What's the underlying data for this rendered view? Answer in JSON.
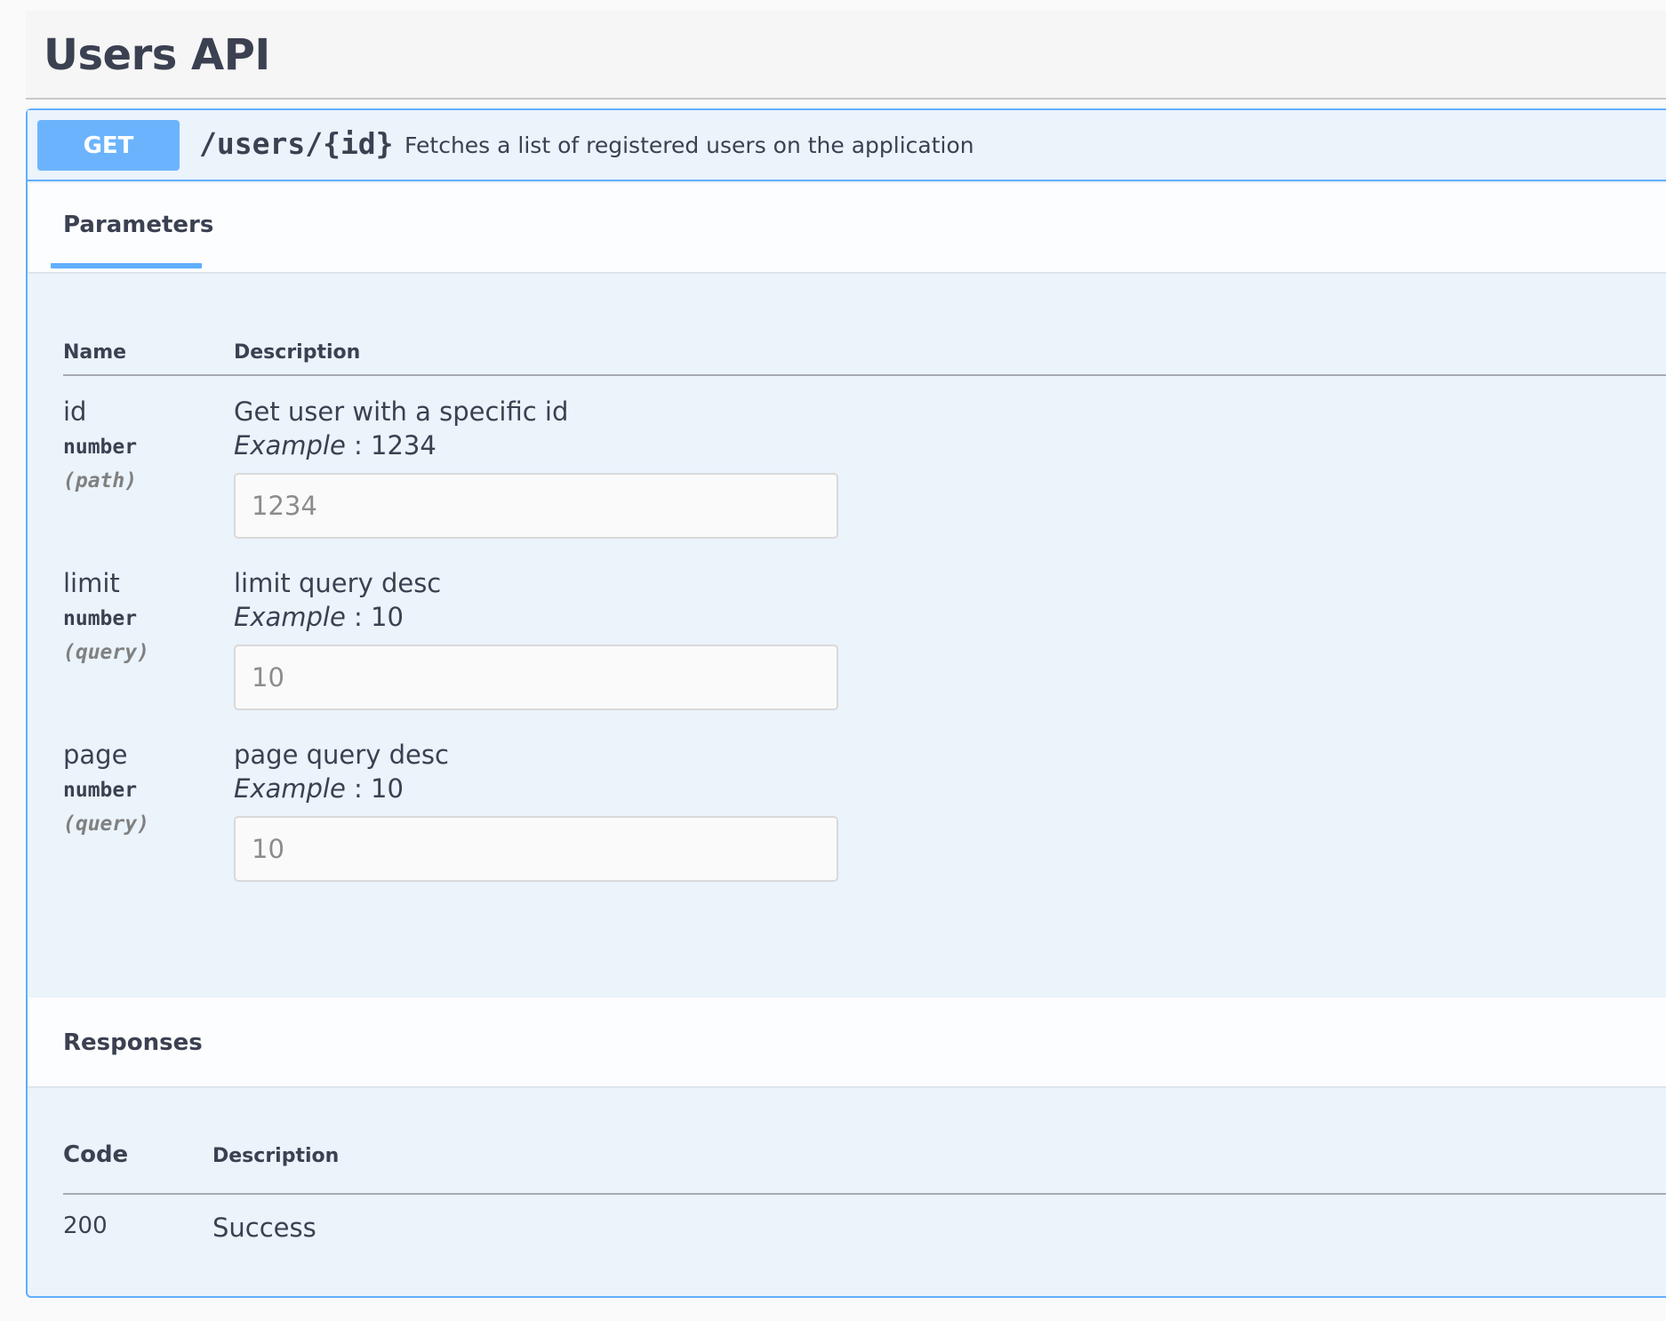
{
  "tag": {
    "title": "Users API"
  },
  "operation": {
    "method": "GET",
    "path": "/users/{id}",
    "summary": "Fetches a list of registered users on the application",
    "method_color": "#61affe"
  },
  "parameters": {
    "tab_label": "Parameters",
    "col_name": "Name",
    "col_description": "Description",
    "items": [
      {
        "name": "id",
        "type": "number",
        "in": "(path)",
        "description": "Get user with a specific id",
        "example_label": "Example",
        "example_value": " : 1234",
        "placeholder": "1234"
      },
      {
        "name": "limit",
        "type": "number",
        "in": "(query)",
        "description": "limit query desc",
        "example_label": "Example",
        "example_value": " : 10",
        "placeholder": "10"
      },
      {
        "name": "page",
        "type": "number",
        "in": "(query)",
        "description": "page query desc",
        "example_label": "Example",
        "example_value": " : 10",
        "placeholder": "10"
      }
    ]
  },
  "responses": {
    "title": "Responses",
    "col_code": "Code",
    "col_description": "Description",
    "items": [
      {
        "code": "200",
        "description": "Success"
      }
    ]
  }
}
